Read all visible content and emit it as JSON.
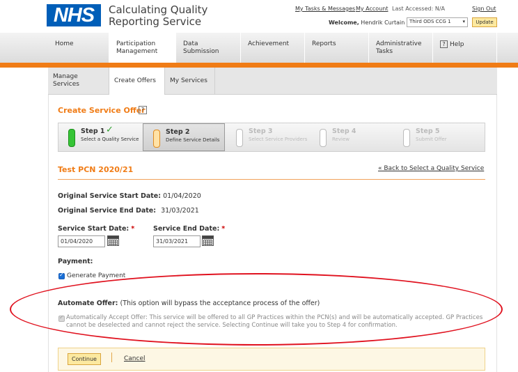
{
  "header": {
    "logo": "NHS",
    "app_title_line1": "Calculating Quality",
    "app_title_line2": "Reporting Service",
    "links": {
      "tasks": "My Tasks & Messages",
      "account": "My Account",
      "last_accessed": "Last Accessed: N/A",
      "signout": "Sign Out"
    },
    "welcome_label": "Welcome,",
    "user_name": "Hendrik Curtain",
    "organisation": "Third ODS CCG 1",
    "update_label": "Update"
  },
  "nav": {
    "items": [
      {
        "label": "Home"
      },
      {
        "label": "Participation Management"
      },
      {
        "label": "Data Submission"
      },
      {
        "label": "Achievement"
      },
      {
        "label": "Reports"
      },
      {
        "label": "Administrative Tasks"
      },
      {
        "label": "Help"
      }
    ],
    "help_icon": "?"
  },
  "subtabs": [
    {
      "label": "Manage Services"
    },
    {
      "label": "Create Offers"
    },
    {
      "label": "My Services"
    }
  ],
  "page": {
    "title": "Create Service Offer",
    "help_icon": "?",
    "steps": [
      {
        "title": "Step 1",
        "sub": "Select a Quality Service",
        "state": "done"
      },
      {
        "title": "Step 2",
        "sub": "Define Service Details",
        "state": "current"
      },
      {
        "title": "Step 3",
        "sub": "Select Service Providers",
        "state": "inactive"
      },
      {
        "title": "Step 4",
        "sub": "Review",
        "state": "inactive"
      },
      {
        "title": "Step 5",
        "sub": "Submit Offer",
        "state": "inactive"
      }
    ],
    "offer_name": "Test PCN 2020/21",
    "back_link": "« Back to Select a Quality Service",
    "original_start_label": "Original Service Start Date:",
    "original_start_value": "01/04/2020",
    "original_end_label": "Original Service End Date:",
    "original_end_value": "31/03/2021",
    "start_date_label": "Service Start Date:",
    "start_date_value": "01/04/2020",
    "end_date_label": "Service End Date:",
    "end_date_value": "31/03/2021",
    "required_mark": "*",
    "payment_label": "Payment:",
    "generate_payment_label": "Generate Payment",
    "generate_payment_checked": true,
    "automate_label": "Automate Offer:",
    "automate_note": "(This option will bypass the acceptance process of the offer)",
    "auto_accept_text": "Automatically Accept Offer: This service will be offered to all GP Practices within the PCN(s) and will be automatically accepted. GP Practices cannot be deselected and cannot reject the service. Selecting Continue will take you to Step 4 for confirmation.",
    "auto_accept_checked": true,
    "continue_label": "Continue",
    "cancel_label": "Cancel"
  },
  "colors": {
    "nhs_blue": "#005eb8",
    "accent_orange": "#f07c16",
    "annotation_red": "#e0121f"
  }
}
